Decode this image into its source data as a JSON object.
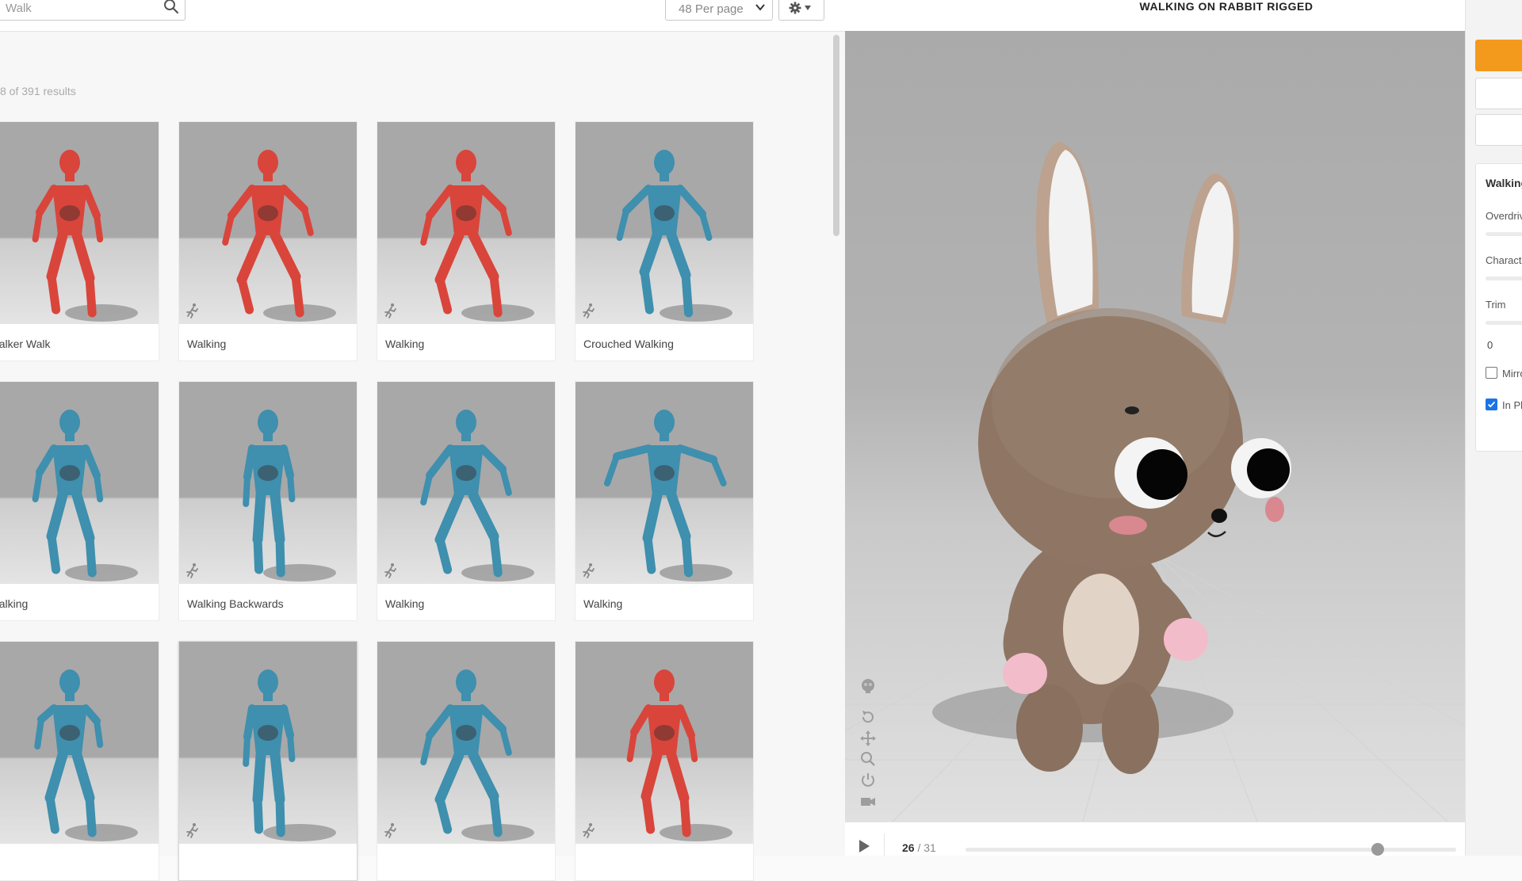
{
  "search": {
    "value": "Walk"
  },
  "toolbar": {
    "per_page": "48 Per page"
  },
  "results": {
    "count_text": "8 of 391 results"
  },
  "cards": [
    {
      "label": "Walker Walk",
      "color": "red",
      "pose": "walk"
    },
    {
      "label": "Walking",
      "color": "red",
      "pose": "stride"
    },
    {
      "label": "Walking",
      "color": "red",
      "pose": "stride"
    },
    {
      "label": "Crouched Walking",
      "color": "blue",
      "pose": "crouch"
    },
    {
      "label": "Walking",
      "color": "blue",
      "pose": "walk"
    },
    {
      "label": "Walking Backwards",
      "color": "blue",
      "pose": "side"
    },
    {
      "label": "Walking",
      "color": "blue",
      "pose": "stride"
    },
    {
      "label": "Walking",
      "color": "blue",
      "pose": "arms"
    },
    {
      "label": "",
      "color": "blue",
      "pose": "guard"
    },
    {
      "label": "",
      "color": "blue",
      "pose": "side"
    },
    {
      "label": "",
      "color": "blue",
      "pose": "stride"
    },
    {
      "label": "",
      "color": "red",
      "pose": "walk"
    }
  ],
  "viewer": {
    "title": "WALKING ON RABBIT RIGGED",
    "frame_current": "26",
    "frame_total": "31",
    "progress": 0.84
  },
  "settings": {
    "title": "Walking",
    "params": [
      "Overdrive",
      "Character Arm-Space",
      "Trim"
    ],
    "trim_value": "0",
    "mirror_label": "Mirror",
    "mirror_checked": false,
    "in_place_label": "In Place",
    "in_place_checked": true
  },
  "colors": {
    "accent": "#f39a1c",
    "figure_red": "#d9453b",
    "figure_blue": "#3f8fae"
  }
}
